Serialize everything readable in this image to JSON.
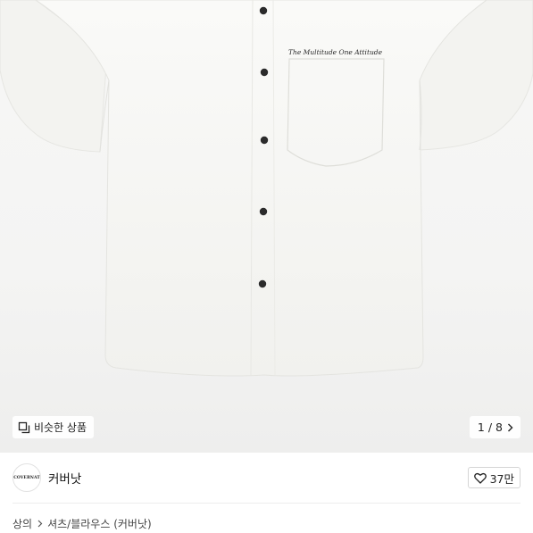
{
  "gallery": {
    "product_image": "white-short-sleeve-shirt",
    "embroidery_text": "The Multitude One Attitude",
    "similar_button_label": "비슷한 상품",
    "similar_icon": "similar-items-icon",
    "pager_text": "1 / 8",
    "pager_icon": "chevron-right-icon"
  },
  "brand": {
    "logo_text": "COVERNAT",
    "name": "커버낫",
    "like_count": "37만",
    "like_icon": "heart-icon"
  },
  "breadcrumb": {
    "level1": "상의",
    "level2": "셔츠/블라우스 (커버낫)",
    "separator_icon": "chevron-right-icon"
  },
  "colors": {
    "shirt": "#f6f6f3",
    "button": "#2b2b2b",
    "background": "#f4f4f3"
  }
}
